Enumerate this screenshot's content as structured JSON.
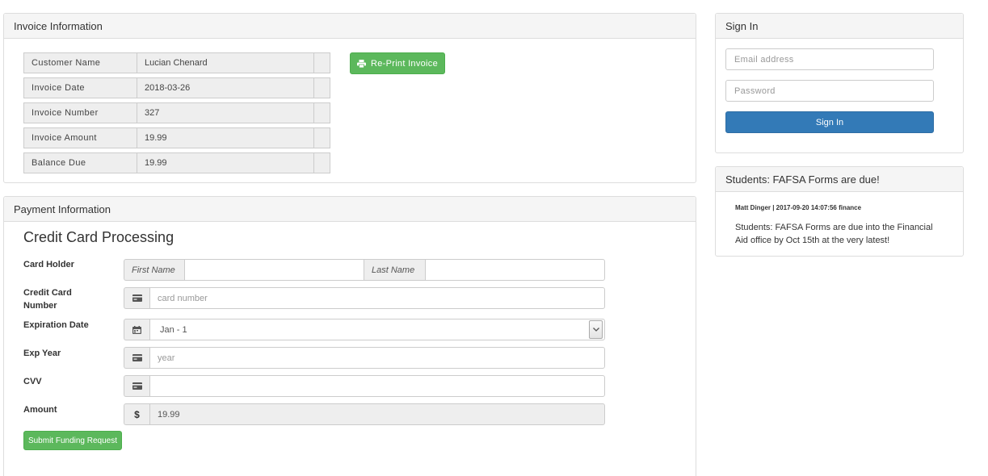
{
  "invoice": {
    "heading": "Invoice Information",
    "rows": [
      {
        "label": "Customer Name",
        "value": "Lucian Chenard"
      },
      {
        "label": "Invoice Date",
        "value": "2018-03-26"
      },
      {
        "label": "Invoice Number",
        "value": "327"
      },
      {
        "label": "Invoice Amount",
        "value": "19.99"
      },
      {
        "label": "Balance Due",
        "value": "19.99"
      }
    ],
    "reprint_label": "Re-Print Invoice",
    "reprint_icon": "printer-icon"
  },
  "payment": {
    "heading": "Payment Information",
    "title": "Credit Card Processing",
    "card_holder_label": "Card Holder",
    "first_name_addon": "First Name",
    "last_name_addon": "Last Name",
    "first_name_value": "",
    "last_name_value": "",
    "card_number_label": "Credit Card Number",
    "card_number_placeholder": "card number",
    "expiration_label": "Expiration Date",
    "expiration_value": "Jan - 1",
    "exp_year_label": "Exp Year",
    "exp_year_placeholder": "year",
    "cvv_label": "CVV",
    "cvv_value": "",
    "amount_label": "Amount",
    "amount_addon": "$",
    "amount_value": "19.99",
    "submit_label": "Submit Funding Request"
  },
  "signin": {
    "heading": "Sign In",
    "email_placeholder": "Email address",
    "password_placeholder": "Password",
    "button_label": "Sign In"
  },
  "news": {
    "heading": "Students: FAFSA Forms are due!",
    "meta": "Matt Dinger | 2017-09-20 14:07:56 finance",
    "body": "Students: FAFSA Forms are due into the Financial Aid office by Oct 15th at the very latest!"
  },
  "colors": {
    "success": "#5cb85c",
    "primary": "#337ab7",
    "panel_heading_bg": "#f5f5f5",
    "border": "#dddddd"
  }
}
